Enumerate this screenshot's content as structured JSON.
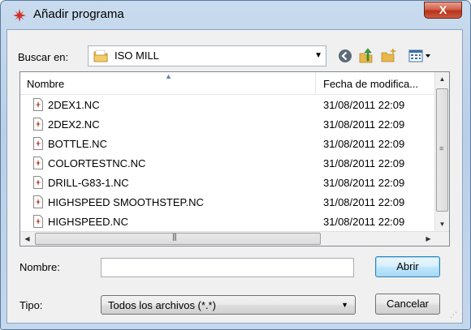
{
  "window": {
    "title": "Añadir programa",
    "close_label": "X"
  },
  "toolbar": {
    "lookin_label": "Buscar en:",
    "lookin_value": "ISO MILL"
  },
  "list": {
    "columns": [
      "Nombre",
      "Fecha de modifica..."
    ],
    "rows": [
      {
        "name": "2DEX1.NC",
        "date": "31/08/2011 22:09"
      },
      {
        "name": "2DEX2.NC",
        "date": "31/08/2011 22:09"
      },
      {
        "name": "BOTTLE.NC",
        "date": "31/08/2011 22:09"
      },
      {
        "name": "COLORTESTNC.NC",
        "date": "31/08/2011 22:09"
      },
      {
        "name": "DRILL-G83-1.NC",
        "date": "31/08/2011 22:09"
      },
      {
        "name": "HIGHSPEED SMOOTHSTEP.NC",
        "date": "31/08/2011 22:09"
      },
      {
        "name": "HIGHSPEED.NC",
        "date": "31/08/2011 22:09"
      }
    ]
  },
  "form": {
    "name_label": "Nombre:",
    "name_value": "",
    "type_label": "Tipo:",
    "type_value": "Todos los archivos (*.*)",
    "open_label": "Abrir",
    "cancel_label": "Cancelar"
  },
  "colors": {
    "accent": "#3c7fb1",
    "file_icon": "#c0392b",
    "folder": "#e8b84a"
  }
}
